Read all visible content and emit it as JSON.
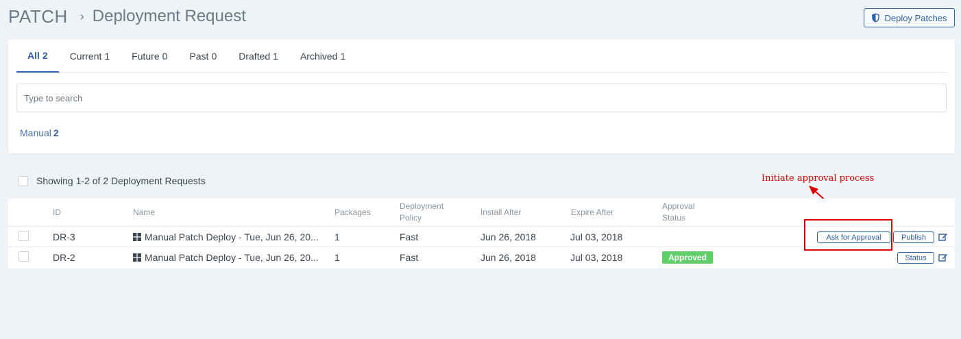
{
  "breadcrumb": {
    "root": "PATCH",
    "separator": "›",
    "page": "Deployment Request"
  },
  "toolbar": {
    "deploy_label": "Deploy Patches"
  },
  "tabs": [
    {
      "label": "All",
      "count": "2",
      "active": true
    },
    {
      "label": "Current",
      "count": "1"
    },
    {
      "label": "Future",
      "count": "0"
    },
    {
      "label": "Past",
      "count": "0"
    },
    {
      "label": "Drafted",
      "count": "1"
    },
    {
      "label": "Archived",
      "count": "1"
    }
  ],
  "search": {
    "placeholder": "Type to search",
    "value": ""
  },
  "filter": {
    "label": "Manual",
    "count": "2"
  },
  "list": {
    "showing": "Showing 1-2 of 2 Deployment Requests"
  },
  "annotation": {
    "text": "Initiate approval process",
    "color": "#d40000"
  },
  "table": {
    "headers": {
      "id": "ID",
      "name": "Name",
      "packages": "Packages",
      "policy_1": "Deployment",
      "policy_2": "Policy",
      "install": "Install After",
      "expire": "Expire After",
      "approval_1": "Approval",
      "approval_2": "Status"
    },
    "rows": [
      {
        "id": "DR-3",
        "name": "Manual Patch Deploy - Tue, Jun 26, 20...",
        "packages": "1",
        "policy": "Fast",
        "install": "Jun 26, 2018",
        "expire": "Jul 03, 2018",
        "status": "",
        "actions": {
          "approve": "Ask for Approval",
          "publish": "Publish"
        }
      },
      {
        "id": "DR-2",
        "name": "Manual Patch Deploy - Tue, Jun 26, 20...",
        "packages": "1",
        "policy": "Fast",
        "install": "Jun 26, 2018",
        "expire": "Jul 03, 2018",
        "status": "Approved",
        "actions": {
          "status": "Status"
        }
      }
    ]
  },
  "colors": {
    "accent": "#2f5fa6",
    "approved": "#5fcf6a",
    "annotation": "#e00000"
  }
}
